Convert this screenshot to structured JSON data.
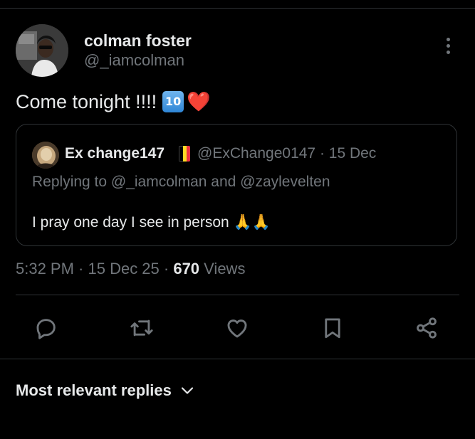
{
  "author": {
    "display_name": "colman foster",
    "handle": "@_iamcolman"
  },
  "tweet": {
    "text": "Come tonight !!!!",
    "emoji_keycap": "10",
    "emoji_heart": "❤️"
  },
  "quoted": {
    "display_name": "Ex change147",
    "meta": "@ExChange0147 · 15 Dec",
    "replying_to": "Replying to @_iamcolman and @zaylevelten",
    "text": "I pray one day I see in person 🙏🙏",
    "flag_colors": [
      "#000000",
      "#fdda24",
      "#ef3340"
    ]
  },
  "stats": {
    "time_date": "5:32 PM · 15 Dec 25 · ",
    "views_count": "670",
    "views_label": " Views"
  },
  "actions": {
    "icons": [
      "reply-icon",
      "retweet-icon",
      "like-icon",
      "bookmark-icon",
      "share-icon"
    ],
    "icon_color": "#71767b"
  },
  "replies": {
    "sort_label": "Most relevant replies"
  },
  "colors": {
    "background": "#000000",
    "primary_text": "#e7e9ea",
    "secondary_text": "#71767b",
    "divider": "#2f3336"
  }
}
